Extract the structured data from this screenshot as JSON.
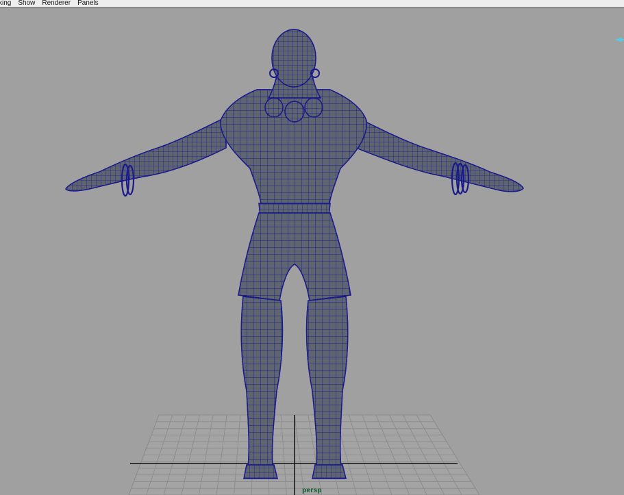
{
  "menubar": {
    "items": [
      "king",
      "Show",
      "Renderer",
      "Panels"
    ]
  },
  "viewport": {
    "camera_label": "persp",
    "background_color": "#a0a0a0",
    "wire_color": "#1a1a8c",
    "mesh_fill_color": "#5e6570",
    "grid_color": "#8a8a8a",
    "axis_color": "#111111",
    "camera_label_color": "#0b5b2a",
    "indicator_color": "#4fd0e6"
  },
  "icons": {
    "view_indicator": "arrow-indicator-icon"
  }
}
